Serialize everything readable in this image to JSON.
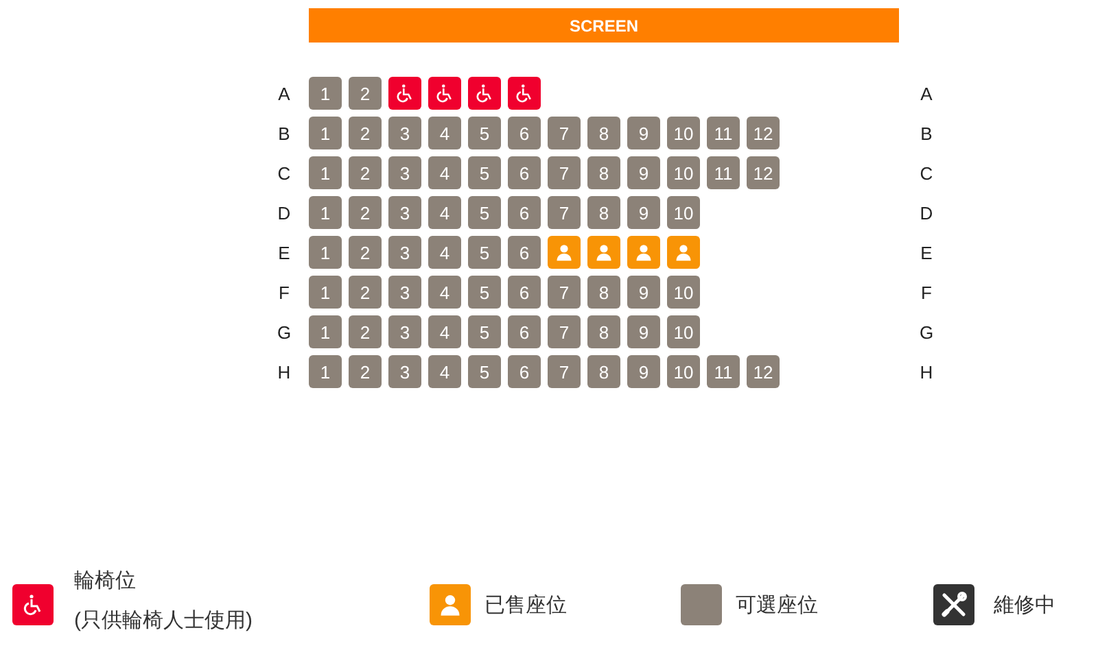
{
  "screen": {
    "label": "SCREEN"
  },
  "rows": [
    {
      "left_label": "A",
      "right_label": "A",
      "seats": [
        {
          "kind": "available",
          "label": "1"
        },
        {
          "kind": "available",
          "label": "2"
        },
        {
          "kind": "wheelchair"
        },
        {
          "kind": "wheelchair"
        },
        {
          "kind": "wheelchair"
        },
        {
          "kind": "wheelchair"
        }
      ]
    },
    {
      "left_label": "B",
      "right_label": "B",
      "seats": [
        {
          "kind": "available",
          "label": "1"
        },
        {
          "kind": "available",
          "label": "2"
        },
        {
          "kind": "available",
          "label": "3"
        },
        {
          "kind": "available",
          "label": "4"
        },
        {
          "kind": "available",
          "label": "5"
        },
        {
          "kind": "available",
          "label": "6"
        },
        {
          "kind": "available",
          "label": "7"
        },
        {
          "kind": "available",
          "label": "8"
        },
        {
          "kind": "available",
          "label": "9"
        },
        {
          "kind": "available",
          "label": "10"
        },
        {
          "kind": "available",
          "label": "11"
        },
        {
          "kind": "available",
          "label": "12"
        }
      ]
    },
    {
      "left_label": "C",
      "right_label": "C",
      "seats": [
        {
          "kind": "available",
          "label": "1"
        },
        {
          "kind": "available",
          "label": "2"
        },
        {
          "kind": "available",
          "label": "3"
        },
        {
          "kind": "available",
          "label": "4"
        },
        {
          "kind": "available",
          "label": "5"
        },
        {
          "kind": "available",
          "label": "6"
        },
        {
          "kind": "available",
          "label": "7"
        },
        {
          "kind": "available",
          "label": "8"
        },
        {
          "kind": "available",
          "label": "9"
        },
        {
          "kind": "available",
          "label": "10"
        },
        {
          "kind": "available",
          "label": "11"
        },
        {
          "kind": "available",
          "label": "12"
        }
      ]
    },
    {
      "left_label": "D",
      "right_label": "D",
      "seats": [
        {
          "kind": "available",
          "label": "1"
        },
        {
          "kind": "available",
          "label": "2"
        },
        {
          "kind": "available",
          "label": "3"
        },
        {
          "kind": "available",
          "label": "4"
        },
        {
          "kind": "available",
          "label": "5"
        },
        {
          "kind": "available",
          "label": "6"
        },
        {
          "kind": "available",
          "label": "7"
        },
        {
          "kind": "available",
          "label": "8"
        },
        {
          "kind": "available",
          "label": "9"
        },
        {
          "kind": "available",
          "label": "10"
        }
      ]
    },
    {
      "left_label": "E",
      "right_label": "E",
      "seats": [
        {
          "kind": "available",
          "label": "1"
        },
        {
          "kind": "available",
          "label": "2"
        },
        {
          "kind": "available",
          "label": "3"
        },
        {
          "kind": "available",
          "label": "4"
        },
        {
          "kind": "available",
          "label": "5"
        },
        {
          "kind": "available",
          "label": "6"
        },
        {
          "kind": "sold"
        },
        {
          "kind": "sold"
        },
        {
          "kind": "sold"
        },
        {
          "kind": "sold"
        }
      ]
    },
    {
      "left_label": "F",
      "right_label": "F",
      "seats": [
        {
          "kind": "available",
          "label": "1"
        },
        {
          "kind": "available",
          "label": "2"
        },
        {
          "kind": "available",
          "label": "3"
        },
        {
          "kind": "available",
          "label": "4"
        },
        {
          "kind": "available",
          "label": "5"
        },
        {
          "kind": "available",
          "label": "6"
        },
        {
          "kind": "available",
          "label": "7"
        },
        {
          "kind": "available",
          "label": "8"
        },
        {
          "kind": "available",
          "label": "9"
        },
        {
          "kind": "available",
          "label": "10"
        }
      ]
    },
    {
      "left_label": "G",
      "right_label": "G",
      "seats": [
        {
          "kind": "available",
          "label": "1"
        },
        {
          "kind": "available",
          "label": "2"
        },
        {
          "kind": "available",
          "label": "3"
        },
        {
          "kind": "available",
          "label": "4"
        },
        {
          "kind": "available",
          "label": "5"
        },
        {
          "kind": "available",
          "label": "6"
        },
        {
          "kind": "available",
          "label": "7"
        },
        {
          "kind": "available",
          "label": "8"
        },
        {
          "kind": "available",
          "label": "9"
        },
        {
          "kind": "available",
          "label": "10"
        }
      ]
    },
    {
      "left_label": "H",
      "right_label": "H",
      "seats": [
        {
          "kind": "available",
          "label": "1"
        },
        {
          "kind": "available",
          "label": "2"
        },
        {
          "kind": "available",
          "label": "3"
        },
        {
          "kind": "available",
          "label": "4"
        },
        {
          "kind": "available",
          "label": "5"
        },
        {
          "kind": "available",
          "label": "6"
        },
        {
          "kind": "available",
          "label": "7"
        },
        {
          "kind": "available",
          "label": "8"
        },
        {
          "kind": "available",
          "label": "9"
        },
        {
          "kind": "available",
          "label": "10"
        },
        {
          "kind": "available",
          "label": "11"
        },
        {
          "kind": "available",
          "label": "12"
        }
      ]
    }
  ],
  "legend": [
    {
      "kind": "wheelchair",
      "label": "輪椅位",
      "note": "(只供輪椅人士使用)"
    },
    {
      "kind": "sold",
      "label": "已售座位"
    },
    {
      "kind": "available",
      "label": "可選座位"
    },
    {
      "kind": "maintenance",
      "label": "維修中"
    }
  ]
}
